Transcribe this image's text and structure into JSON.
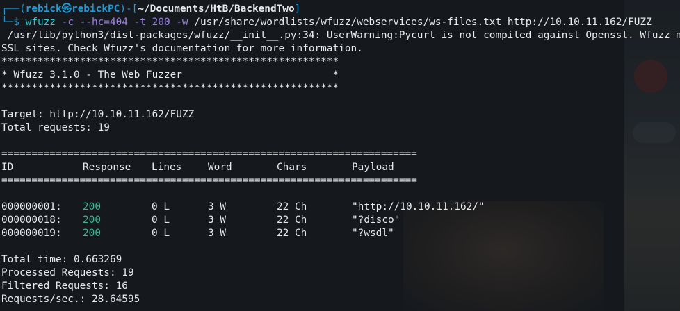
{
  "prompt": {
    "user_host": "rebick㉿rebickPC",
    "path": "~/Documents/HtB/BackendTwo",
    "command_name": "wfuzz",
    "command_flags": "-c --hc=404 -t 200 -w",
    "wordlist": "/usr/share/wordlists/wfuzz/webservices/ws-files.txt",
    "target_arg": "http://10.10.11.162/FUZZ"
  },
  "warning": [
    " /usr/lib/python3/dist-packages/wfuzz/__init__.py:34: UserWarning:Pycurl is not compiled against Openssl. Wfuzz might not work correctly when fuzzing",
    "SSL sites. Check Wfuzz's documentation for more information."
  ],
  "banner": {
    "stars": "********************************************************",
    "title": "* Wfuzz 3.1.0 - The Web Fuzzer                         *"
  },
  "target_line": "Target: http://10.10.11.162/FUZZ",
  "total_requests_line": "Total requests: 19",
  "separator": "=====================================================================",
  "table": {
    "headers": {
      "id": "ID",
      "response": "Response",
      "lines": "Lines",
      "word": "Word",
      "chars": "Chars",
      "payload": "Payload"
    },
    "rows": [
      {
        "id": "000000001:",
        "response": "200",
        "lines": "0 L",
        "word": "3 W",
        "chars": "22 Ch",
        "payload": "\"http://10.10.11.162/\""
      },
      {
        "id": "000000018:",
        "response": "200",
        "lines": "0 L",
        "word": "3 W",
        "chars": "22 Ch",
        "payload": "\"?disco\""
      },
      {
        "id": "000000019:",
        "response": "200",
        "lines": "0 L",
        "word": "3 W",
        "chars": "22 Ch",
        "payload": "\"?wsdl\""
      }
    ]
  },
  "summary": {
    "total_time": "Total time: 0.663269",
    "processed": "Processed Requests: 19",
    "filtered": "Filtered Requests: 16",
    "rate": "Requests/sec.: 28.64595"
  },
  "colors": {
    "background": "#15191e",
    "prompt": "#1f9bd6",
    "command": "#31c9d0",
    "flags": "#9b80e0",
    "status_ok": "#3bb78f",
    "text": "#e8eaec"
  }
}
